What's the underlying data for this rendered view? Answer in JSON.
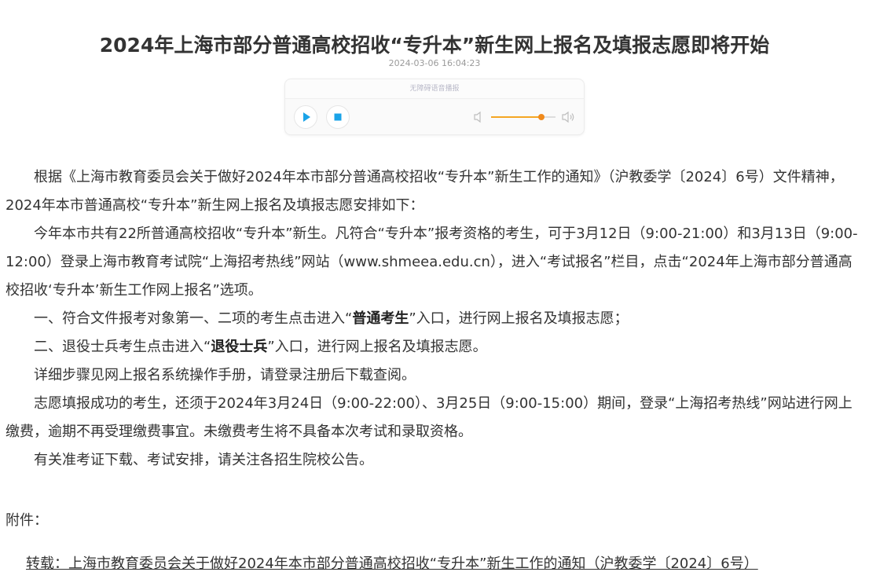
{
  "article": {
    "title": "2024年上海市部分普通高校招收“专升本”新生网上报名及填报志愿即将开始",
    "date": "2024-03-06 16:04:23"
  },
  "player": {
    "header_label": "无障碍语音播报",
    "play_icon": "play-icon",
    "stop_icon": "stop-icon",
    "volume": 0.78,
    "accent_color": "#f08a1c",
    "button_color": "#1aa3e8"
  },
  "body": {
    "p1": "根据《上海市教育委员会关于做好2024年本市部分普通高校招收“专升本”新生工作的通知》（沪教委学〔2024〕6号）文件精神，2024年本市普通高校“专升本”新生网上报名及填报志愿安排如下：",
    "p2": "今年本市共有22所普通高校招收“专升本”新生。凡符合“专升本”报考资格的考生，可于3月12日（9:00-21:00）和3月13日（9:00-12:00）登录上海市教育考试院“上海招考热线”网站（www.shmeea.edu.cn），进入“考试报名”栏目，点击“2024年上海市部分普通高校招收‘专升本’新生工作网上报名”选项。",
    "p3_before": "一、符合文件报考对象第一、二项的考生点击进入“",
    "p3_bold": "普通考生",
    "p3_after": "”入口，进行网上报名及填报志愿；",
    "p4_before": "二、退役士兵考生点击进入“",
    "p4_bold": "退役士兵",
    "p4_after": "”入口，进行网上报名及填报志愿。",
    "p5": "详细步骤见网上报名系统操作手册，请登录注册后下载查阅。",
    "p6": "志愿填报成功的考生，还须于2024年3月24日（9:00-22:00）、3月25日（9:00-15:00）期间，登录“上海招考热线”网站进行网上缴费，逾期不再受理缴费事宜。未缴费考生将不具备本次考试和录取资格。",
    "p7": "有关准考证下载、考试安排，请关注各招生院校公告。"
  },
  "attachments": {
    "label": "附件：",
    "link_text": "转载：上海市教育委员会关于做好2024年本市部分普通高校招收“专升本”新生工作的通知（沪教委学〔2024〕6号）"
  }
}
